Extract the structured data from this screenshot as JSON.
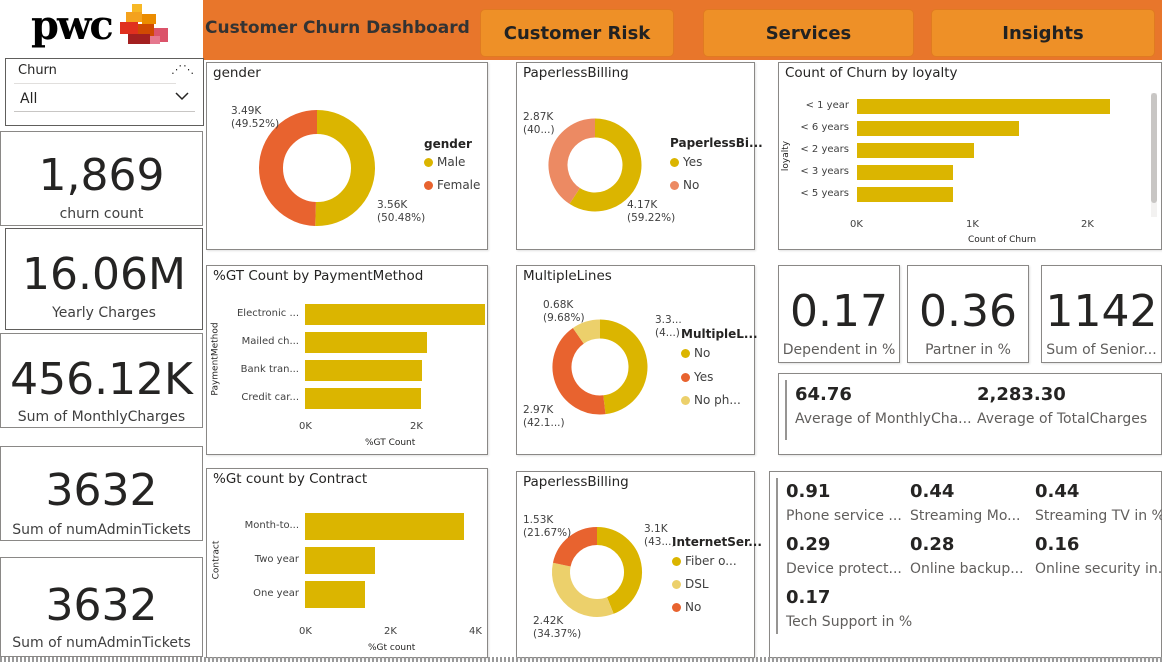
{
  "header": {
    "logo_text": "pwc",
    "title": "Customer Churn Dashboard",
    "nav": [
      "Customer Risk",
      "Services",
      "Insights"
    ]
  },
  "slicer": {
    "title": "Churn",
    "value": "All"
  },
  "kpis": [
    {
      "value": "1,869",
      "label": "churn count"
    },
    {
      "value": "16.06M",
      "label": "Yearly Charges"
    },
    {
      "value": "456.12K",
      "label": "Sum of MonthlyCharges"
    },
    {
      "value": "3632",
      "label": "Sum of numAdminTickets"
    },
    {
      "value": "3632",
      "label": "Sum of numAdminTickets"
    }
  ],
  "gender": {
    "title": "gender",
    "legend_title": "gender",
    "legend": [
      "Male",
      "Female"
    ],
    "label_female": "3.49K\n(49.52%)",
    "label_male": "3.56K\n(50.48%)"
  },
  "paperless1": {
    "title": "PaperlessBilling",
    "legend_title": "PaperlessBi...",
    "legend": [
      "Yes",
      "No"
    ],
    "label_no": "2.87K\n(40...)",
    "label_yes": "4.17K\n(59.22%)"
  },
  "loyalty": {
    "title": "Count of Churn by loyalty",
    "ylabel": "loyalty",
    "xlabel": "Count of Churn",
    "xticks": [
      "0K",
      "1K",
      "2K"
    ]
  },
  "payment": {
    "title": "%GT Count by PaymentMethod",
    "ylabel": "PaymentMethod",
    "xlabel": "%GT Count",
    "xticks": [
      "0K",
      "2K"
    ]
  },
  "multiplelines": {
    "title": "MultipleLines",
    "legend_title": "MultipleL...",
    "legend": [
      "No",
      "Yes",
      "No ph..."
    ],
    "label_phone": "0.68K\n(9.68%)",
    "label_no": "3.3...\n(4...)",
    "label_yes": "2.97K\n(42.1...)"
  },
  "contract": {
    "title": "%Gt count by Contract",
    "ylabel": "Contract",
    "xlabel": "%Gt count",
    "xticks": [
      "0K",
      "2K",
      "4K"
    ]
  },
  "paperless2": {
    "title": "PaperlessBilling",
    "legend_title": "InternetSer...",
    "legend": [
      "Fiber o...",
      "DSL",
      "No"
    ],
    "label_no": "1.53K\n(21.67%)",
    "label_fiber": "3.1K\n(43...)",
    "label_dsl": "2.42K\n(34.37%)"
  },
  "ratio_cards": [
    {
      "value": "0.17",
      "label": "Dependent in %"
    },
    {
      "value": "0.36",
      "label": "Partner in %"
    },
    {
      "value": "1142",
      "label": "Sum of Senior..."
    }
  ],
  "avg_card": [
    {
      "value": "64.76",
      "label": "Average of MonthlyCha..."
    },
    {
      "value": "2,283.30",
      "label": "Average of TotalCharges"
    }
  ],
  "services_card": [
    {
      "value": "0.91",
      "label": "Phone service ..."
    },
    {
      "value": "0.44",
      "label": "Streaming Mo..."
    },
    {
      "value": "0.44",
      "label": "Streaming TV in %"
    },
    {
      "value": "0.29",
      "label": "Device protect..."
    },
    {
      "value": "0.28",
      "label": "Online backup..."
    },
    {
      "value": "0.16",
      "label": "Online security in..."
    },
    {
      "value": "0.17",
      "label": "Tech Support in %"
    }
  ],
  "colors": {
    "header": "#e8762b",
    "nav_button": "#ee9027",
    "gold": "#dbb500",
    "orange": "#e8632f",
    "salmon": "#ec8a63",
    "light_gold": "#ecd06b"
  },
  "chart_data": [
    {
      "type": "pie",
      "title": "gender",
      "categories": [
        "Male",
        "Female"
      ],
      "values": [
        3560,
        3490
      ],
      "percent": [
        50.48,
        49.52
      ]
    },
    {
      "type": "pie",
      "title": "PaperlessBilling",
      "categories": [
        "Yes",
        "No"
      ],
      "values": [
        4170,
        2870
      ],
      "percent": [
        59.22,
        40.78
      ]
    },
    {
      "type": "bar",
      "title": "Count of Churn by loyalty",
      "categories": [
        "< 1 year",
        "< 6 years",
        "< 2 years",
        "< 3 years",
        "< 5 years"
      ],
      "values": [
        2180,
        1400,
        1010,
        830,
        830
      ],
      "xlabel": "Count of Churn",
      "ylabel": "loyalty",
      "xlim": [
        0,
        2500
      ],
      "orientation": "horizontal"
    },
    {
      "type": "bar",
      "title": "%GT Count by PaymentMethod",
      "categories": [
        "Electronic ...",
        "Mailed ch...",
        "Bank tran...",
        "Credit car..."
      ],
      "values": [
        2370,
        1610,
        1540,
        1520
      ],
      "xlabel": "%GT Count",
      "ylabel": "PaymentMethod",
      "xlim": [
        0,
        2500
      ],
      "orientation": "horizontal"
    },
    {
      "type": "pie",
      "title": "MultipleLines",
      "categories": [
        "No",
        "Yes",
        "No ph..."
      ],
      "values": [
        3390,
        2970,
        680
      ],
      "percent": [
        48.2,
        42.1,
        9.68
      ]
    },
    {
      "type": "bar",
      "title": "%Gt count by Contract",
      "categories": [
        "Month-to...",
        "Two year",
        "One year"
      ],
      "values": [
        3880,
        1700,
        1470
      ],
      "xlabel": "%Gt count",
      "ylabel": "Contract",
      "xlim": [
        0,
        4200
      ],
      "orientation": "horizontal"
    },
    {
      "type": "pie",
      "title": "PaperlessBilling",
      "categories": [
        "Fiber o...",
        "DSL",
        "No"
      ],
      "values": [
        3100,
        2420,
        1530
      ],
      "percent": [
        43.96,
        34.37,
        21.67
      ]
    }
  ]
}
